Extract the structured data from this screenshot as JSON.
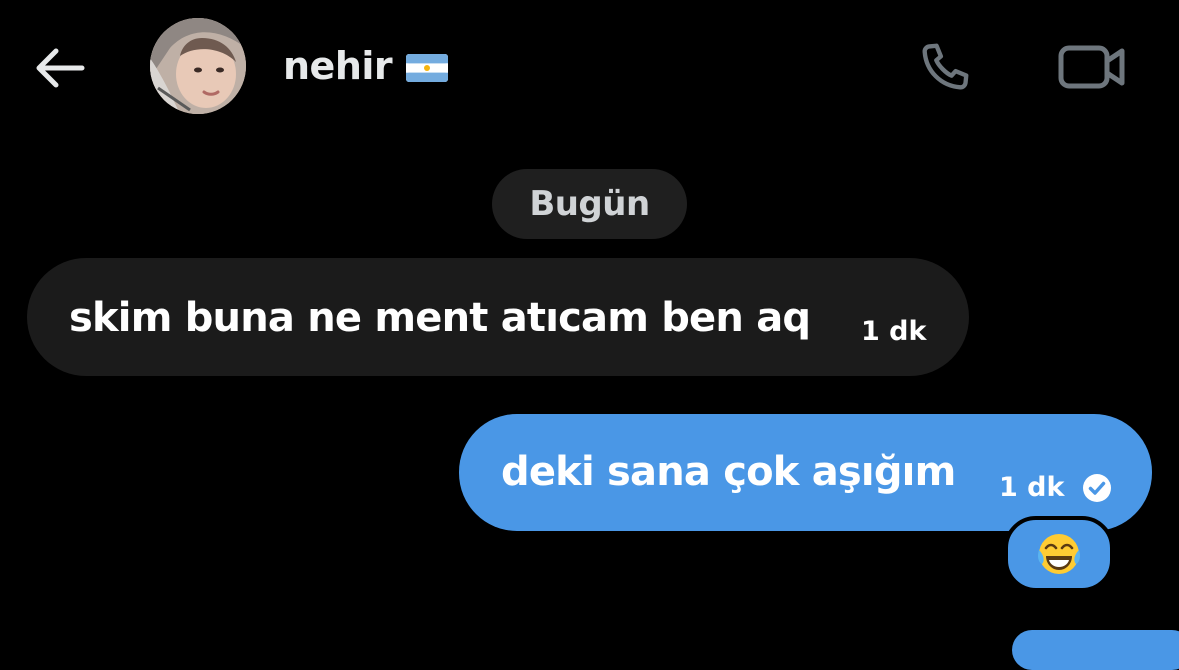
{
  "header": {
    "back_icon": "arrow-left-icon",
    "contact_name": "nehir",
    "flag": "argentina-flag-emoji",
    "call_icon": "phone-icon",
    "video_icon": "video-camera-icon"
  },
  "divider": {
    "date_label": "Bugün"
  },
  "messages": [
    {
      "direction": "incoming",
      "text": "skim buna ne ment atıcam ben aq",
      "time": "1 dk"
    },
    {
      "direction": "outgoing",
      "text": "deki sana çok aşığım",
      "time": "1 dk",
      "status_icon": "read-check-icon",
      "reaction": "face-with-tears-of-joy-emoji"
    }
  ],
  "colors": {
    "background": "#000000",
    "incoming_bubble": "#1b1b1b",
    "outgoing_bubble": "#4a97e6",
    "date_pill": "#1f1f1f",
    "icon_gray": "#6e767d"
  }
}
